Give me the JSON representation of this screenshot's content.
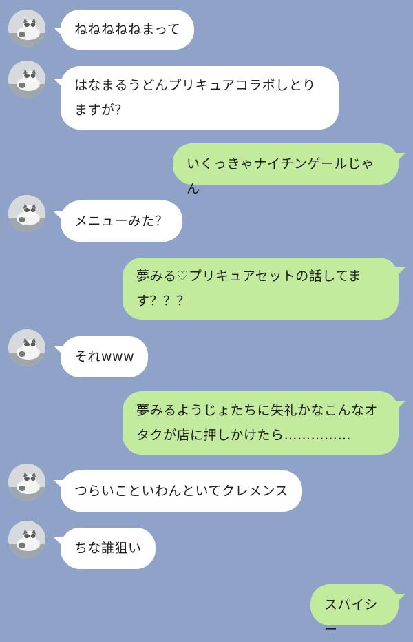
{
  "colors": {
    "background": "#8fa2c8",
    "incoming_bubble": "#ffffff",
    "outgoing_bubble": "#c2eb9e",
    "text": "#1e1e1e"
  },
  "messages": [
    {
      "side": "in",
      "avatar_icon": "cat-avatar-icon",
      "lines": [
        "ねねねねねまって"
      ]
    },
    {
      "side": "in",
      "avatar_icon": "cat-avatar-icon",
      "lines": [
        "はなまるうどんプリキュアコラボしとり",
        "ますが？"
      ]
    },
    {
      "side": "out",
      "lines": [
        "いくっきゃナイチンゲールじゃん"
      ]
    },
    {
      "side": "in",
      "avatar_icon": "cat-avatar-icon",
      "lines": [
        "メニューみた？"
      ]
    },
    {
      "side": "out",
      "lines": [
        "夢みる♡プリキュアセットの話してま",
        "す？？？"
      ]
    },
    {
      "side": "in",
      "avatar_icon": "cat-avatar-icon",
      "lines": [
        "それwww"
      ]
    },
    {
      "side": "out",
      "lines": [
        "夢みるようじょたちに失礼かなこんなオ",
        "タクが店に押しかけたら……………"
      ]
    },
    {
      "side": "in",
      "avatar_icon": "cat-avatar-icon",
      "lines": [
        "つらいこといわんといてクレメンス"
      ]
    },
    {
      "side": "in",
      "avatar_icon": "cat-avatar-icon",
      "lines": [
        "ちな誰狙い"
      ]
    },
    {
      "side": "out",
      "lines": [
        "スパイシー"
      ]
    }
  ]
}
